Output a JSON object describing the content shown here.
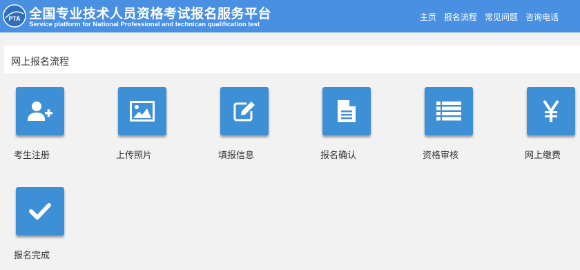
{
  "header": {
    "title": "全国专业技术人员资格考试报名服务平台",
    "subtitle": "Service platform for National Professional and technican qualification test",
    "logo_text": "PTA",
    "bg_color": "#4a90e2"
  },
  "nav": {
    "items": [
      "主页",
      "报名流程",
      "常见问题",
      "咨询电话"
    ]
  },
  "section": {
    "title": "网上报名流程"
  },
  "steps": [
    {
      "label": "考生注册",
      "icon": "user-add-icon"
    },
    {
      "label": "上传照片",
      "icon": "image-icon"
    },
    {
      "label": "填报信息",
      "icon": "edit-icon"
    },
    {
      "label": "报名确认",
      "icon": "document-icon"
    },
    {
      "label": "资格审核",
      "icon": "list-icon"
    },
    {
      "label": "网上缴费",
      "icon": "yen-icon"
    },
    {
      "label": "报名完成",
      "icon": "check-icon"
    }
  ],
  "colors": {
    "tile": "#3d8fd6",
    "page_bg": "#f2f2f2"
  }
}
